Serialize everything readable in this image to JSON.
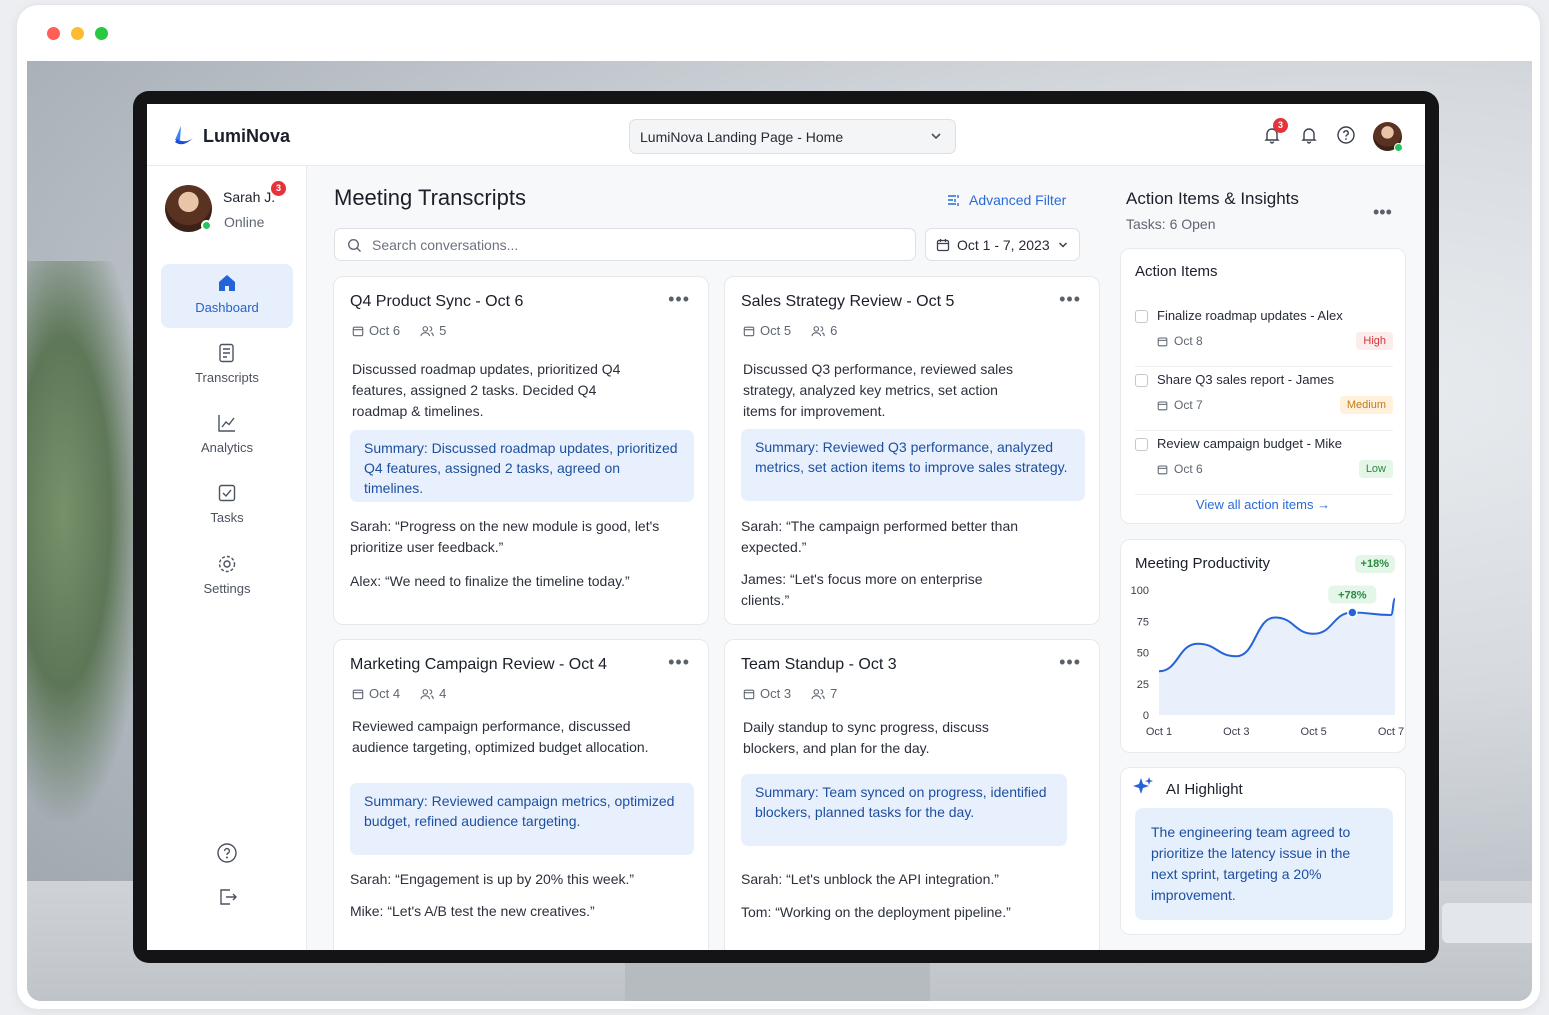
{
  "app": {
    "name": "LumiNova",
    "page_selector": "LumiNova Landing Page - Home",
    "notification_count": "3"
  },
  "user": {
    "name": "Sarah J.",
    "status": "Online",
    "badge": "3"
  },
  "nav": [
    {
      "label": "Dashboard",
      "icon": "home-icon",
      "active": true
    },
    {
      "label": "Transcripts",
      "icon": "document-icon"
    },
    {
      "label": "Analytics",
      "icon": "line-chart-icon"
    },
    {
      "label": "Tasks",
      "icon": "checkbox-icon"
    },
    {
      "label": "Settings",
      "icon": "gear-icon"
    }
  ],
  "main": {
    "title": "Meeting Transcripts",
    "advanced_filter": "Advanced Filter",
    "search_placeholder": "Search conversations...",
    "date_range": "Oct 1 - 7, 2023"
  },
  "cards": [
    {
      "title": "Q4 Product Sync - Oct 6",
      "date": "Oct 6",
      "people": "5",
      "desc": "Discussed roadmap updates, prioritized Q4 features, assigned 2 tasks. Decided Q4 roadmap & timelines.",
      "summary": "Summary: Discussed roadmap updates, prioritized Q4 features, assigned 2 tasks, agreed on timelines.",
      "quotes": [
        "Sarah: “Progress on the new module is good, let's prioritize user feedback.”",
        "Alex: “We need to finalize the timeline today.”"
      ]
    },
    {
      "title": "Sales Strategy Review - Oct 5",
      "date": "Oct 5",
      "people": "6",
      "desc": "Discussed Q3 performance, reviewed sales strategy, analyzed key metrics, set action items for improvement.",
      "summary": "Summary: Reviewed Q3 performance, analyzed metrics, set action items to improve sales strategy.",
      "quotes": [
        "Sarah: “The campaign performed better than expected.”",
        "James: “Let's focus more on enterprise clients.”"
      ]
    },
    {
      "title": "Marketing Campaign Review - Oct 4",
      "date": "Oct 4",
      "people": "4",
      "desc": "Reviewed campaign performance, discussed audience targeting, optimized budget allocation.",
      "summary": "Summary: Reviewed campaign metrics, optimized budget, refined audience targeting.",
      "quotes": [
        "Sarah: “Engagement is up by 20% this week.”",
        "Mike: “Let's A/B test the new creatives.”"
      ]
    },
    {
      "title": "Team Standup - Oct 3",
      "date": "Oct 3",
      "people": "7",
      "desc": "Daily standup to sync progress, discuss blockers, and plan for the day.",
      "summary": "Summary: Team synced on progress, identified blockers, planned tasks for the day.",
      "quotes": [
        "Sarah: “Let's unblock the API integration.”",
        "Tom: “Working on the deployment pipeline.”"
      ]
    }
  ],
  "insights": {
    "title": "Action Items & Insights",
    "subtitle": "Tasks: 6 Open",
    "action_title": "Action Items",
    "items": [
      {
        "label": "Finalize roadmap updates - Alex",
        "date": "Oct 8",
        "priority": "High"
      },
      {
        "label": "Share Q3 sales report - James",
        "date": "Oct 7",
        "priority": "Medium"
      },
      {
        "label": "Review campaign budget - Mike",
        "date": "Oct 6",
        "priority": "Low"
      }
    ],
    "view_all": "View all action items →",
    "productivity_title": "Meeting Productivity",
    "productivity_change": "+18%",
    "ai_title": "AI Highlight",
    "ai_text": "The engineering team agreed to prioritize the latency issue in the next sprint, targeting a 20% improvement."
  },
  "chart_data": {
    "type": "line",
    "title": "Meeting Productivity",
    "x": [
      "Oct 1",
      "Oct 2",
      "Oct 3",
      "Oct 4",
      "Oct 5",
      "Oct 6",
      "Oct 7"
    ],
    "x_tick_labels": [
      "Oct 1",
      "Oct 3",
      "Oct 5",
      "Oct 7"
    ],
    "series": [
      {
        "values": [
          35,
          57,
          47,
          78,
          65,
          82,
          80
        ]
      }
    ],
    "final_value": 93,
    "highlight": {
      "x": "Oct 6",
      "value": 82,
      "label": "+78%"
    },
    "ylim": [
      0,
      100
    ],
    "y_ticks": [
      0,
      25,
      50,
      75,
      100
    ],
    "grid": false,
    "color": "#2563d9"
  }
}
